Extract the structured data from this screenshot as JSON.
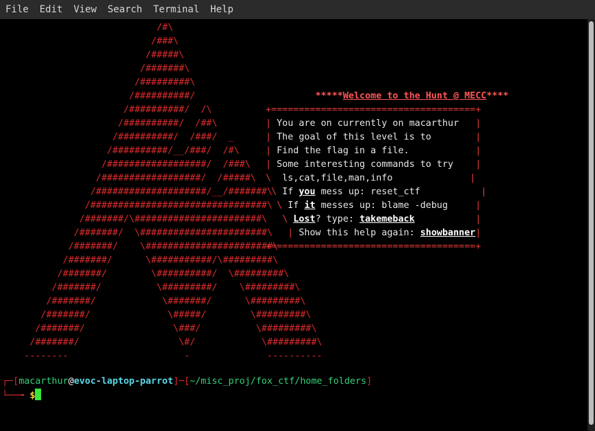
{
  "menu": [
    "File",
    "Edit",
    "View",
    "Search",
    "Terminal",
    "Help"
  ],
  "art_lines": [
    "                            /#\\",
    "                           /###\\",
    "                          /#####\\",
    "                         /#######\\",
    "                        /#########\\",
    "                       /##########/",
    "                      /##########/  /\\",
    "                     /##########/  /##\\",
    "                    /##########/  /###/  _",
    "                   /##########/__/###/  /#\\",
    "                  /##################/  /###\\",
    "                 /##################/  /#####\\",
    "                /####################/__/#######\\",
    "               /################################\\",
    "              /#######/\\#######################\\",
    "             /#######/  \\#######################\\",
    "            /#######/    \\#######################\\",
    "           /#######/      \\###########/\\#########\\",
    "          /#######/        \\##########/  \\#########\\",
    "         /#######/          \\#########/    \\#########\\",
    "        /#######/            \\#######/      \\#########\\",
    "       /#######/              \\#####/        \\#########\\",
    "      /#######/                \\###/          \\#########\\",
    "     /#######/                  \\#/            \\#########\\",
    "    --------                     -              ----------"
  ],
  "banner": {
    "title_prefix": "*****",
    "title": "Welcome to the Hunt @ MECC",
    "title_suffix": "****",
    "border": "+=====================================+",
    "line1": " You are on currently on macarthur",
    "line2": " The goal of this level is to",
    "line3": " Find the flag in a file.",
    "line4": " Some interesting commands to try",
    "line5": "  ls,cat,file,man,info",
    "line6a": " If ",
    "line6b": "you",
    "line6c": " mess up: reset_ctf",
    "line7a": " If ",
    "line7b": "it",
    "line7c": " messes up: blame -debug",
    "line8b": "Lost",
    "line8c": "? type: ",
    "line8d": "takemeback",
    "line9a": " Show this help again: ",
    "line9b": "showbanner"
  },
  "prompt": {
    "user": "macarthur",
    "at": "@",
    "host": "evoc-laptop-parrot",
    "path": "~/misc_proj/fox_ctf/home_folders",
    "symbol": "$"
  },
  "colors": {
    "art": "#d92b2b",
    "user": "#33d17a",
    "host": "#5ad7e6",
    "cursor": "#39e639"
  }
}
